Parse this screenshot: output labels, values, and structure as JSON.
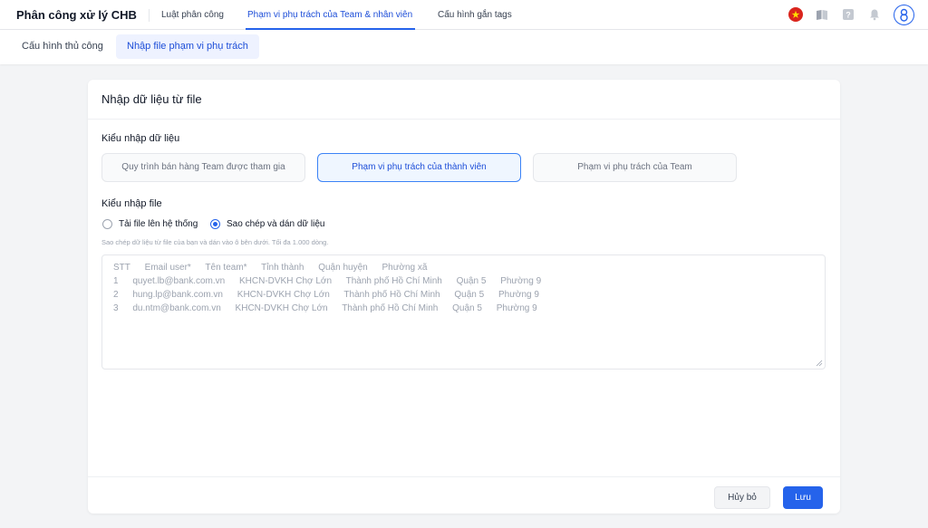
{
  "app": {
    "title": "Phân công xử lý CHB"
  },
  "nav": {
    "tabs": [
      {
        "label": "Luật phân công"
      },
      {
        "label": "Phạm vi phụ trách của Team & nhân viên"
      },
      {
        "label": "Cấu hình gắn tags"
      }
    ],
    "active_index": 1
  },
  "toolbar_icons": [
    "vietnam-flag-icon",
    "book-icon",
    "help-icon",
    "bell-icon",
    "user-avatar-icon"
  ],
  "subnav": {
    "tabs": [
      {
        "label": "Cấu hình thủ công"
      },
      {
        "label": "Nhập file phạm vi phụ trách"
      }
    ],
    "active_index": 1
  },
  "card": {
    "title": "Nhập dữ liệu từ file",
    "import_type": {
      "label": "Kiểu nhập dữ liệu",
      "options": [
        {
          "label": "Quy trình bán hàng Team được tham gia"
        },
        {
          "label": "Phạm vi phụ trách của thành viên"
        },
        {
          "label": "Phạm vi phụ trách của Team"
        }
      ],
      "selected_index": 1
    },
    "file_type": {
      "label": "Kiểu nhập file",
      "options": [
        {
          "label": "Tải file lên hệ thống"
        },
        {
          "label": "Sao chép và dán dữ liệu"
        }
      ],
      "selected_index": 1
    },
    "hint": "Sao chép dữ liệu từ file của bạn và dán vào ô bên dưới. Tối đa 1.000 dòng.",
    "placeholder": {
      "header": [
        "STT",
        "Email user*",
        "Tên team*",
        "Tỉnh thành",
        "Quận huyện",
        "Phường xã"
      ],
      "rows": [
        [
          "1",
          "quyet.lb@bank.com.vn",
          "KHCN-DVKH Chợ Lớn",
          "Thành phố Hồ Chí Minh",
          "Quận 5",
          "Phường 9"
        ],
        [
          "2",
          "hung.lp@bank.com.vn",
          "KHCN-DVKH Chợ Lớn",
          "Thành phố Hồ Chí Minh",
          "Quận 5",
          "Phường 9"
        ],
        [
          "3",
          "du.ntm@bank.com.vn",
          "KHCN-DVKH Chợ Lớn",
          "Thành phố Hồ Chí Minh",
          "Quận 5",
          "Phường 9"
        ]
      ]
    },
    "buttons": {
      "cancel": "Hủy bỏ",
      "save": "Lưu"
    }
  },
  "colors": {
    "accent": "#2563eb",
    "flag": "#da251d"
  }
}
